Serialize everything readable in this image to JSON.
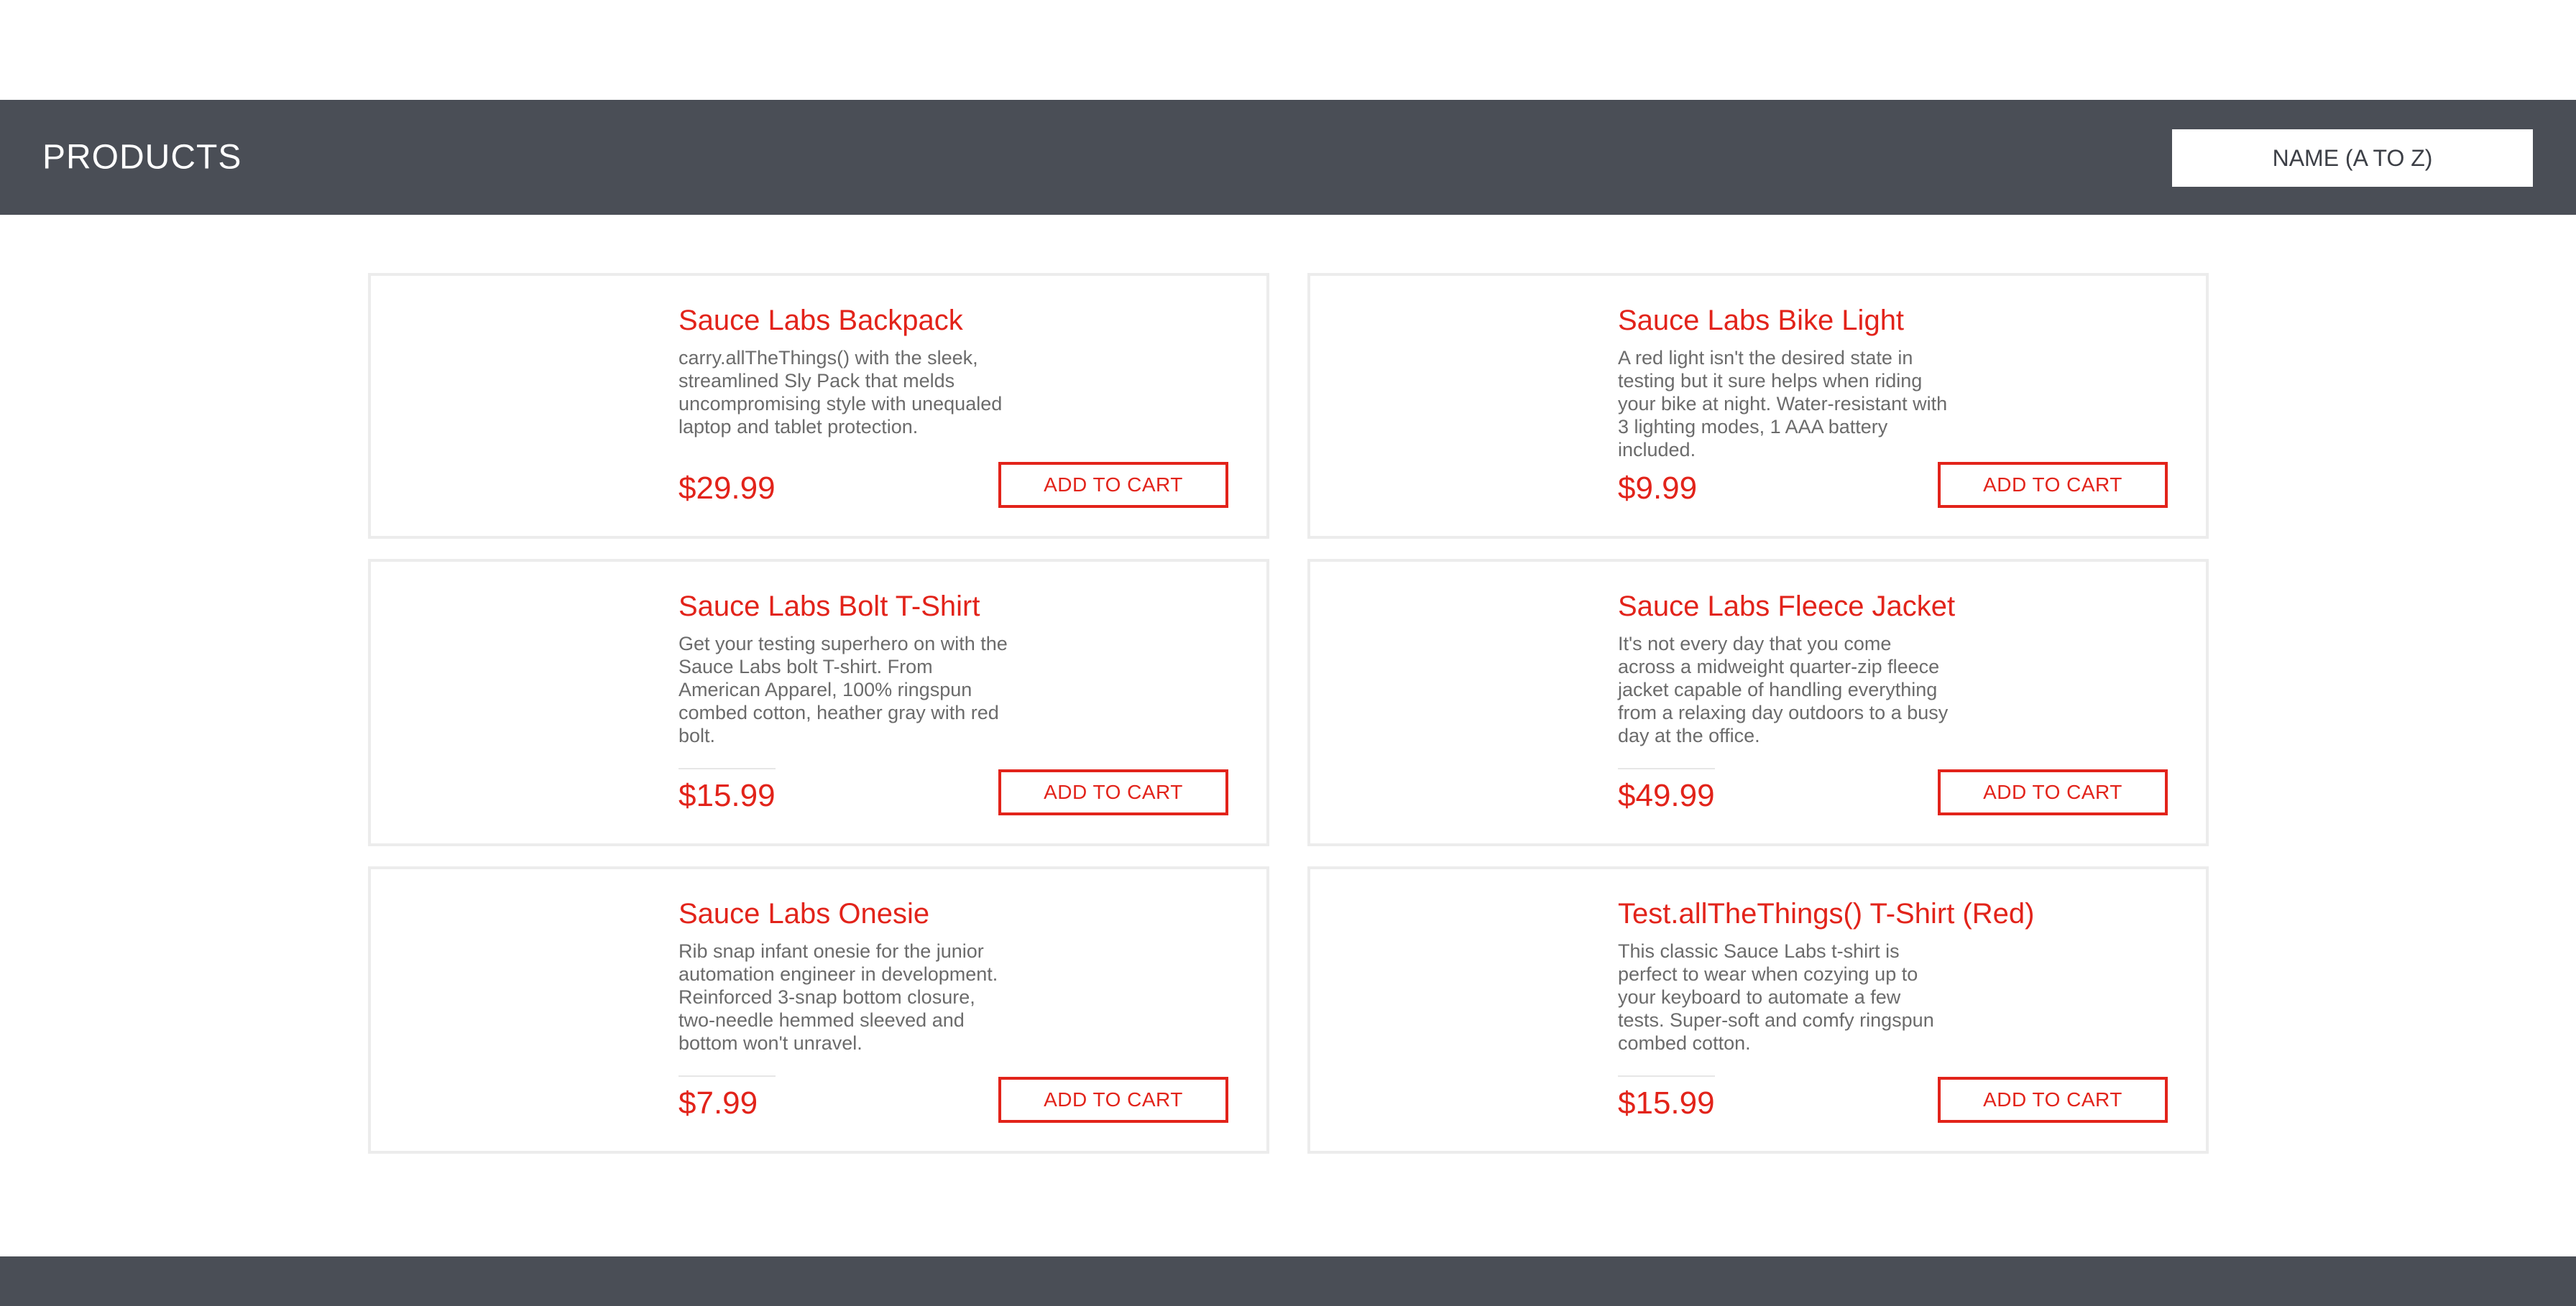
{
  "header": {
    "title": "PRODUCTS",
    "sort_selected": "NAME (A TO Z)"
  },
  "colors": {
    "header_background": "#4a4e56",
    "accent_red": "#e2231a",
    "description_gray": "#6b6b6b",
    "card_border": "#ececec"
  },
  "products": [
    {
      "name": "Sauce Labs Backpack",
      "description": "carry.allTheThings() with the sleek, streamlined Sly Pack that melds uncompromising style with unequaled laptop and tablet protection.",
      "price": "$29.99",
      "button_label": "ADD TO CART"
    },
    {
      "name": "Sauce Labs Bike Light",
      "description": "A red light isn't the desired state in testing but it sure helps when riding your bike at night. Water-resistant with 3 lighting modes, 1 AAA battery included.",
      "price": "$9.99",
      "button_label": "ADD TO CART"
    },
    {
      "name": "Sauce Labs Bolt T-Shirt",
      "description": "Get your testing superhero on with the Sauce Labs bolt T-shirt. From American Apparel, 100% ringspun combed cotton, heather gray with red bolt.",
      "price": "$15.99",
      "button_label": "ADD TO CART"
    },
    {
      "name": "Sauce Labs Fleece Jacket",
      "description": "It's not every day that you come across a midweight quarter-zip fleece jacket capable of handling everything from a relaxing day outdoors to a busy day at the office.",
      "price": "$49.99",
      "button_label": "ADD TO CART"
    },
    {
      "name": "Sauce Labs Onesie",
      "description": "Rib snap infant onesie for the junior automation engineer in development. Reinforced 3-snap bottom closure, two-needle hemmed sleeved and bottom won't unravel.",
      "price": "$7.99",
      "button_label": "ADD TO CART"
    },
    {
      "name": "Test.allTheThings() T-Shirt (Red)",
      "description": "This classic Sauce Labs t-shirt is perfect to wear when cozying up to your keyboard to automate a few tests. Super-soft and comfy ringspun combed cotton.",
      "price": "$15.99",
      "button_label": "ADD TO CART"
    }
  ]
}
